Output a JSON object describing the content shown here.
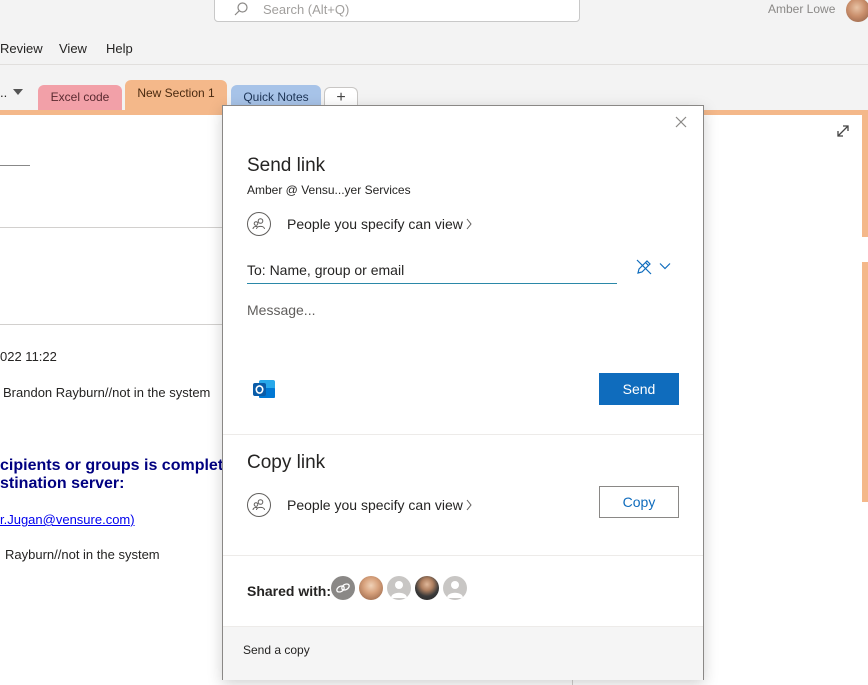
{
  "titlebar": {
    "search_placeholder": "Search (Alt+Q)",
    "user_name": "Amber Lowe"
  },
  "menubar": {
    "items": [
      "Review",
      "View",
      "Help"
    ]
  },
  "tabs": {
    "notebook_ellipsis": "..",
    "items": [
      "Excel code",
      "New Section 1",
      "Quick Notes"
    ],
    "add_label": "+"
  },
  "page": {
    "lines": [
      "022 11:22",
      "Brandon Rayburn//not in the system",
      "cipients or groups is complet",
      "stination server:",
      "r.Jugan@vensure.com)",
      "Rayburn//not in the system"
    ]
  },
  "dialog": {
    "send_link": {
      "title": "Send link",
      "subtitle": "Amber @ Vensu...yer Services",
      "permission": "People you specify can view",
      "to_placeholder": "To: Name, group or email",
      "message_placeholder": "Message...",
      "send_label": "Send"
    },
    "copy_link": {
      "title": "Copy link",
      "permission": "People you specify can view",
      "copy_label": "Copy"
    },
    "shared_with_label": "Shared with:",
    "footer_label": "Send a copy"
  },
  "colors": {
    "accent": "#0f6cbd",
    "tab_excel": "#f2a0a8",
    "tab_new_section": "#f4b88a",
    "tab_quick_notes": "#a7c3e8",
    "page_bold_text": "#000080"
  }
}
